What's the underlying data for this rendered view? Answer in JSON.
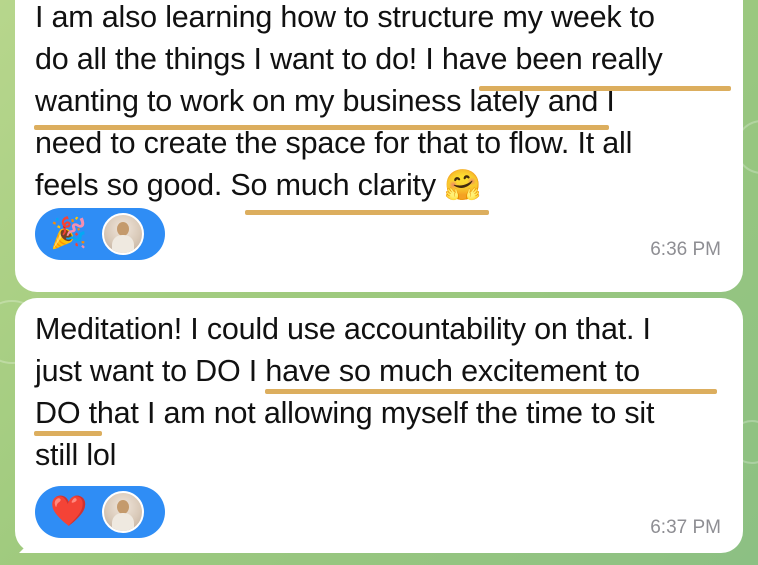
{
  "colors": {
    "bubble": "#ffffff",
    "reaction_pill": "#2f8df5",
    "highlight_underline": "#dcae5e",
    "time_text": "#8e8e93",
    "wallpaper": "#9fca7e"
  },
  "messages": [
    {
      "lines": [
        "I am also learning how to structure my week to",
        "do all the things I want to do! I have been really",
        "wanting to work on my business lately and I",
        "need to create the space for that to flow. It all",
        "feels so good. So much clarity"
      ],
      "trailing_emoji": "🤗",
      "reactions": [
        {
          "emoji": "🎉",
          "icon": "party-popper-icon"
        }
      ],
      "time": "6:36 PM"
    },
    {
      "lines": [
        "Meditation! I could use accountability on that. I",
        "just want to DO I have so much excitement to",
        "DO that I am not allowing myself the time to sit",
        "still lol"
      ],
      "reactions": [
        {
          "emoji": "❤️",
          "icon": "red-heart-icon"
        }
      ],
      "time": "6:37 PM"
    }
  ]
}
